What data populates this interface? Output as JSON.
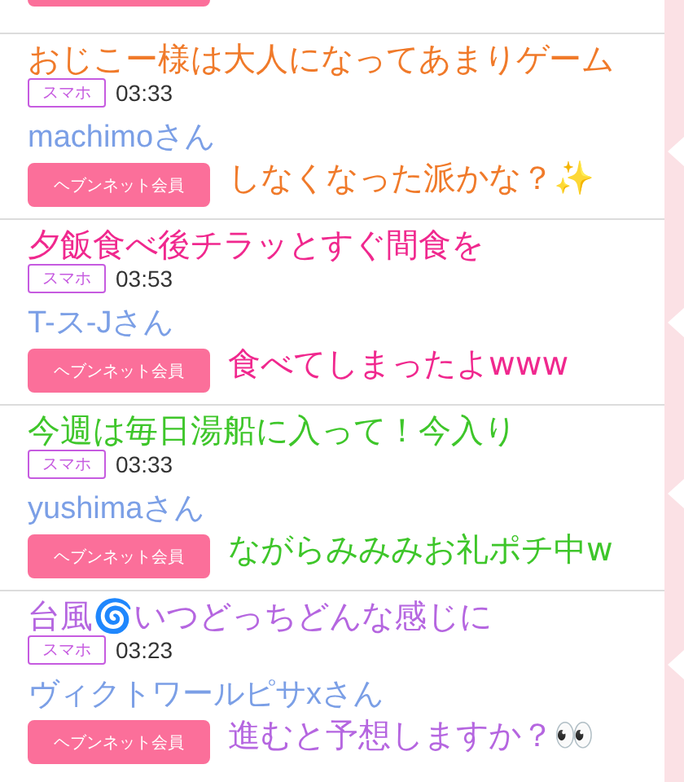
{
  "cards": [
    {
      "device": "スマホ",
      "time": "03:33",
      "name": "machimoさん",
      "member": "ヘブンネット会員",
      "caption": {
        "color": "#f07a2a",
        "lines": [
          "おじこー様は大人になってあまりゲーム",
          "しなくなった派かな？✨"
        ]
      }
    },
    {
      "device": "スマホ",
      "time": "03:53",
      "name": "T-ス-Jさん",
      "member": "ヘブンネット会員",
      "caption": {
        "color": "#f0288e",
        "lines": [
          "夕飯食べ後チラッとすぐ間食を",
          "食べてしまったよwww"
        ]
      }
    },
    {
      "device": "スマホ",
      "time": "03:33",
      "name": "yushimaさん",
      "member": "ヘブンネット会員",
      "caption": {
        "color": "#3ec62a",
        "lines": [
          "今週は毎日湯船に入って！今入り",
          "ながらみみみお礼ポチ中w"
        ]
      }
    },
    {
      "device": "スマホ",
      "time": "03:23",
      "name": "ヴィクトワールピサxさん",
      "member": "ヘブンネット会員",
      "caption": {
        "color": "#b566e0",
        "lines": [
          "台風🌀いつどっちどんな感じに",
          "進むと予想しますか？👀"
        ]
      }
    }
  ]
}
